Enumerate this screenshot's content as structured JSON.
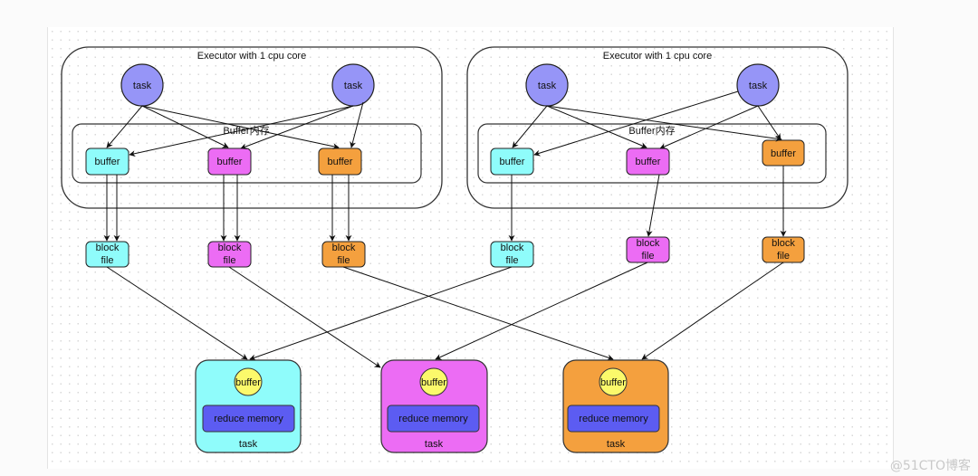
{
  "colors": {
    "task": "#9695f7",
    "cyan": "#8ffcfb",
    "magenta": "#ec6cf4",
    "orange": "#f4a03e",
    "yellow": "#fbf96b",
    "reduce_memory": "#5c5cf2",
    "stroke": "#222222"
  },
  "executors": [
    {
      "title": "Executor with 1 cpu core",
      "buffer_region_label": "Buffer内存",
      "tasks": [
        {
          "label": "task"
        },
        {
          "label": "task"
        }
      ],
      "buffers": [
        {
          "label": "buffer",
          "color": "cyan"
        },
        {
          "label": "buffer",
          "color": "magenta"
        },
        {
          "label": "buffer",
          "color": "orange"
        }
      ],
      "block_files": [
        {
          "label_line1": "block",
          "label_line2": "file",
          "color": "cyan"
        },
        {
          "label_line1": "block",
          "label_line2": "file",
          "color": "magenta"
        },
        {
          "label_line1": "block",
          "label_line2": "file",
          "color": "orange"
        }
      ]
    },
    {
      "title": "Executor with 1 cpu core",
      "buffer_region_label": "Buffer内存",
      "tasks": [
        {
          "label": "task"
        },
        {
          "label": "task"
        }
      ],
      "buffers": [
        {
          "label": "buffer",
          "color": "cyan"
        },
        {
          "label": "buffer",
          "color": "magenta"
        },
        {
          "label": "buffer",
          "color": "orange"
        }
      ],
      "block_files": [
        {
          "label_line1": "block",
          "label_line2": "file",
          "color": "cyan"
        },
        {
          "label_line1": "block",
          "label_line2": "file",
          "color": "magenta"
        },
        {
          "label_line1": "block",
          "label_line2": "file",
          "color": "orange"
        }
      ]
    }
  ],
  "reduce_tasks": [
    {
      "label": "task",
      "buffer_label": "buffer",
      "memory_label": "reduce memory",
      "color": "cyan"
    },
    {
      "label": "task",
      "buffer_label": "buffer",
      "memory_label": "reduce memory",
      "color": "magenta"
    },
    {
      "label": "task",
      "buffer_label": "buffer",
      "memory_label": "reduce memory",
      "color": "orange"
    }
  ],
  "watermark": "@51CTO博客"
}
